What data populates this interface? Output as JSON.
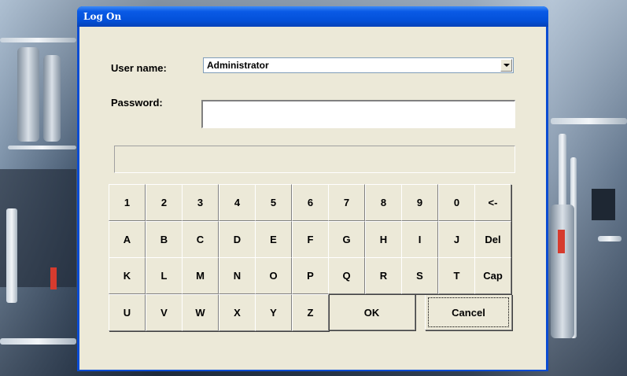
{
  "window": {
    "title": "Log On"
  },
  "form": {
    "username_label": "User name:",
    "username_value": "Administrator",
    "password_label": "Password:",
    "password_value": "",
    "message": ""
  },
  "keyboard": {
    "rows": [
      [
        "1",
        "2",
        "3",
        "4",
        "5",
        "6",
        "7",
        "8",
        "9",
        "0",
        "<-"
      ],
      [
        "A",
        "B",
        "C",
        "D",
        "E",
        "F",
        "G",
        "H",
        "I",
        "J",
        "Del"
      ],
      [
        "K",
        "L",
        "M",
        "N",
        "O",
        "P",
        "Q",
        "R",
        "S",
        "T",
        "Cap"
      ],
      [
        "U",
        "V",
        "W",
        "X",
        "Y",
        "Z"
      ]
    ],
    "ok_label": "OK",
    "cancel_label": "Cancel"
  },
  "colors": {
    "titlebar": "#0a5ae6",
    "face": "#ece9d8"
  }
}
